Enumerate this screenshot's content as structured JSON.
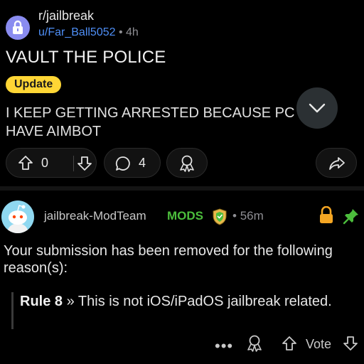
{
  "post": {
    "subreddit": "r/jailbreak",
    "author": "u/Far_Ball5052",
    "separator": "•",
    "age": "4h",
    "title": "VAULT THE POLICE",
    "flair": "Update",
    "body": "I KEEP GETTING ARRESTED BECAUSE PC\nHAVE AIMBOT",
    "score": "0",
    "comments": "4"
  },
  "comment": {
    "author": "jailbreak-ModTeam",
    "badge": "MODS",
    "separator": "•",
    "age": "56m",
    "body": "Your submission has been removed for the following reason(s):",
    "rule_label": "Rule 8",
    "rule_text": " » This is not iOS/iPadOS jailbreak related.",
    "more": "•••",
    "vote_label": "Vote"
  },
  "colors": {
    "background": "#000000",
    "flair": "#ffd635",
    "username_link": "#4f8ff7",
    "mod_green": "#4cbd3c",
    "lock": "#f5a623"
  },
  "icons": [
    "lock-icon",
    "chevron-down-icon",
    "upvote-icon",
    "downvote-icon",
    "comment-icon",
    "award-icon",
    "share-icon",
    "shield-icon",
    "pin-icon"
  ]
}
